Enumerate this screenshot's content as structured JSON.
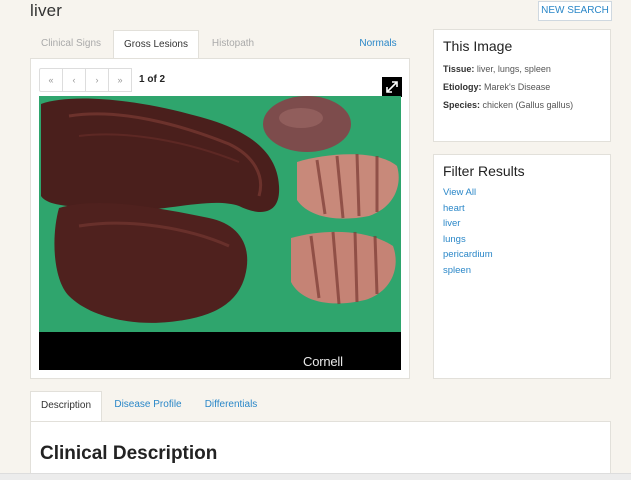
{
  "page": {
    "title": "liver",
    "new_search_label": "NEW SEARCH"
  },
  "image_tabs": {
    "items": [
      {
        "label": "Clinical Signs"
      },
      {
        "label": "Gross Lesions"
      },
      {
        "label": "Histopath"
      }
    ],
    "normals_link": "Normals"
  },
  "pager": {
    "first": "«",
    "prev": "‹",
    "next": "›",
    "last": "»",
    "count_text": "1 of 2"
  },
  "photo": {
    "watermark": "Cornell University"
  },
  "this_image": {
    "title": "This Image",
    "tissue_label": "Tissue:",
    "tissue_value": " liver, lungs, spleen",
    "etiology_label": "Etiology:",
    "etiology_value": " Marek's Disease",
    "species_label": "Species:",
    "species_value": " chicken (Gallus gallus)"
  },
  "filter_results": {
    "title": "Filter Results",
    "items": [
      "View All",
      "heart",
      "liver",
      "lungs",
      "pericardium",
      "spleen"
    ]
  },
  "bottom_tabs": {
    "items": [
      {
        "label": "Description"
      },
      {
        "label": "Disease Profile"
      },
      {
        "label": "Differentials"
      }
    ]
  },
  "description": {
    "title": "Clinical Description"
  },
  "colors": {
    "link": "#2a87c8",
    "photo_background": "#2fa56d"
  }
}
